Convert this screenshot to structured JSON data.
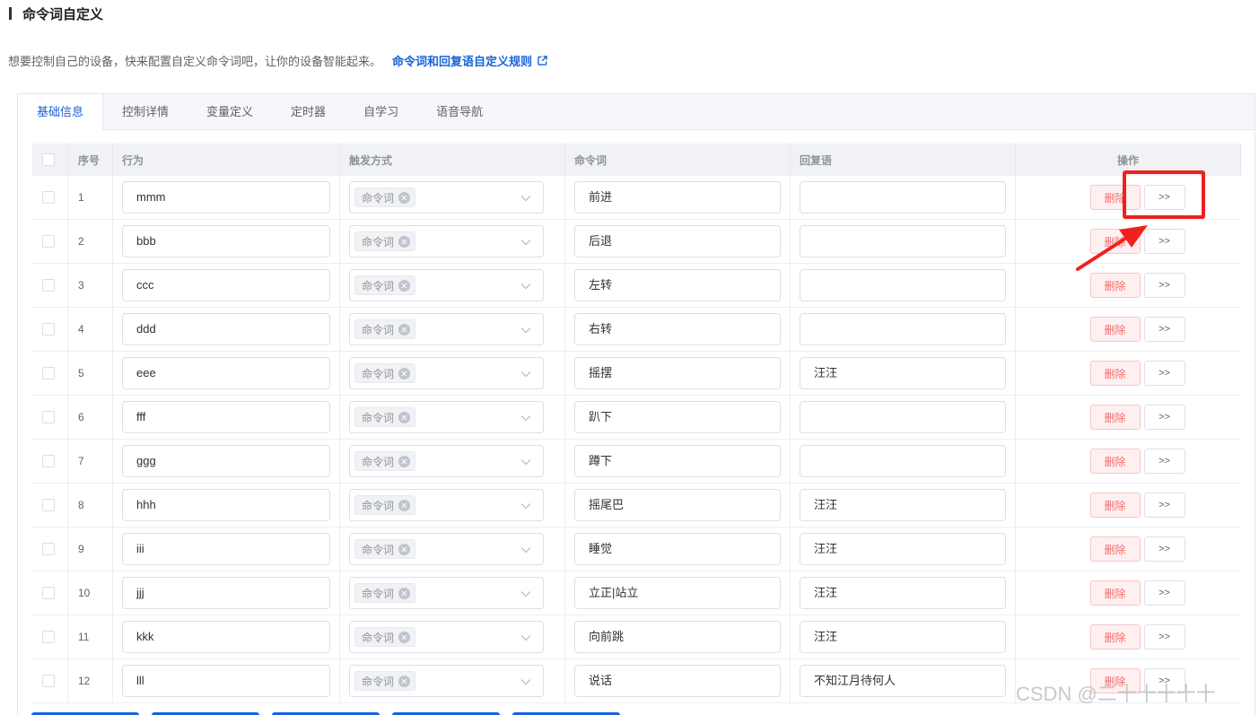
{
  "page": {
    "title": "命令词自定义",
    "intro": "想要控制自己的设备，快来配置自定义命令词吧，让你的设备智能起来。",
    "rules_link": "命令词和回复语自定义规则"
  },
  "tabs": [
    "基础信息",
    "控制详情",
    "变量定义",
    "定时器",
    "自学习",
    "语音导航"
  ],
  "table": {
    "headers": {
      "index": "序号",
      "behavior": "行为",
      "trigger": "触发方式",
      "command": "命令词",
      "reply": "回复语",
      "actions": "操作"
    },
    "delete_label": "删除",
    "more_label": ">>",
    "trigger_tag": "命令词",
    "rows": [
      {
        "index": "1",
        "behavior": "mmm",
        "command": "前进",
        "reply": ""
      },
      {
        "index": "2",
        "behavior": "bbb",
        "command": "后退",
        "reply": ""
      },
      {
        "index": "3",
        "behavior": "ccc",
        "command": "左转",
        "reply": ""
      },
      {
        "index": "4",
        "behavior": "ddd",
        "command": "右转",
        "reply": ""
      },
      {
        "index": "5",
        "behavior": "eee",
        "command": "摇摆",
        "reply": "汪汪"
      },
      {
        "index": "6",
        "behavior": "fff",
        "command": "趴下",
        "reply": ""
      },
      {
        "index": "7",
        "behavior": "ggg",
        "command": "蹲下",
        "reply": ""
      },
      {
        "index": "8",
        "behavior": "hhh",
        "command": "摇尾巴",
        "reply": "汪汪"
      },
      {
        "index": "9",
        "behavior": "iii",
        "command": "睡觉",
        "reply": "汪汪"
      },
      {
        "index": "10",
        "behavior": "jjj",
        "command": "立正|站立",
        "reply": "汪汪"
      },
      {
        "index": "11",
        "behavior": "kkk",
        "command": "向前跳",
        "reply": "汪汪"
      },
      {
        "index": "12",
        "behavior": "lll",
        "command": "说话",
        "reply": "不知江月待何人"
      }
    ]
  },
  "watermark": "CSDN @二十十十十十",
  "colors": {
    "primary": "#1664d9",
    "danger": "#f56c6c",
    "annotation": "#f0211d"
  }
}
